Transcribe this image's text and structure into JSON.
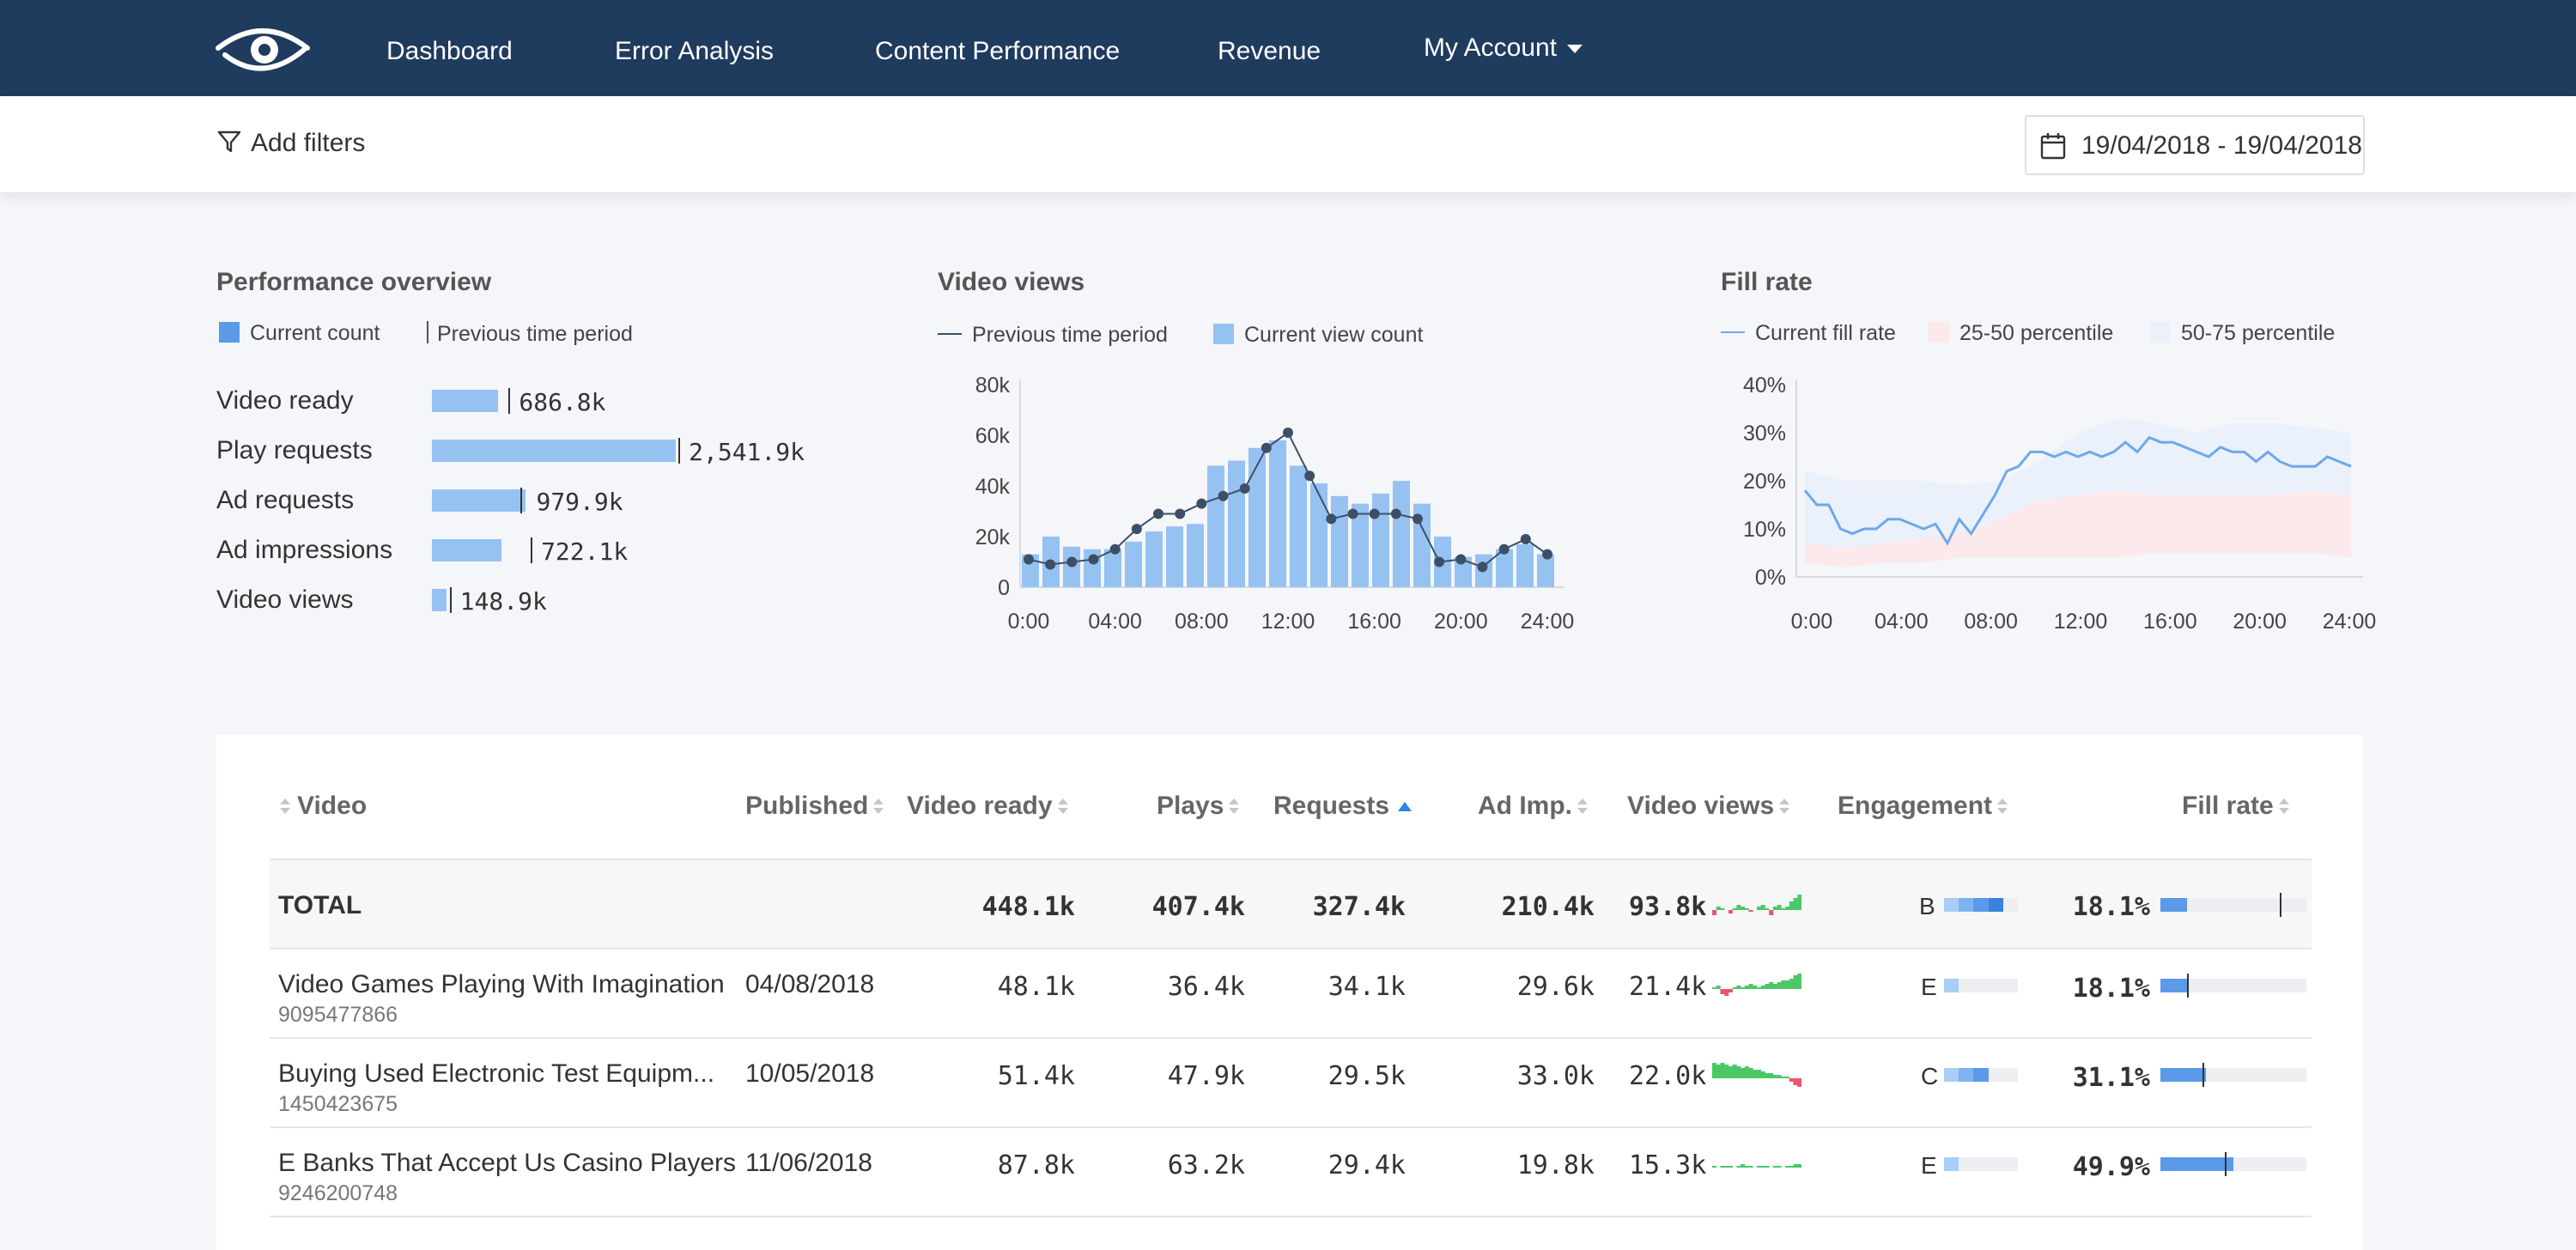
{
  "nav": {
    "items": [
      "Dashboard",
      "Error Analysis",
      "Content Performance",
      "Revenue"
    ],
    "account": "My Account"
  },
  "filters": {
    "add_label": "Add filters",
    "date_range": "19/04/2018 - 19/04/2018"
  },
  "performance": {
    "title": "Performance overview",
    "legend": [
      "Current count",
      "Previous time period"
    ],
    "rows": [
      {
        "label": "Video ready",
        "value": "686.8k",
        "current": 686.8,
        "previous": 800
      },
      {
        "label": "Play requests",
        "value": "2,541.9k",
        "current": 2541.9,
        "previous": 2570
      },
      {
        "label": "Ad requests",
        "value": "979.9k",
        "current": 979.9,
        "previous": 920
      },
      {
        "label": "Ad impressions",
        "value": "722.1k",
        "current": 722.1,
        "previous": 1030
      },
      {
        "label": "Video views",
        "value": "148.9k",
        "current": 148.9,
        "previous": 185
      }
    ]
  },
  "colors": {
    "nav_bg": "#1f3b5e",
    "bar": "#96c2f2",
    "line": "#3d4f66",
    "fill_line": "#6ea8ec",
    "band_low": "#fbe9ec",
    "band_high": "#eaf1fb",
    "positive": "#4cc766",
    "negative": "#e8566d",
    "accent": "#2e82ec"
  },
  "video_views": {
    "title": "Video views",
    "legend": [
      "Previous time period",
      "Current view count"
    ],
    "chart_data": {
      "type": "bar",
      "x_ticks": [
        "0:00",
        "04:00",
        "08:00",
        "12:00",
        "16:00",
        "20:00",
        "24:00"
      ],
      "y_ticks": [
        "80k",
        "60k",
        "40k",
        "20k",
        "0"
      ],
      "ylim": [
        0,
        80000
      ],
      "series": [
        {
          "name": "Current view count",
          "type": "bar",
          "values": [
            13000,
            20000,
            16000,
            15000,
            15000,
            18000,
            22000,
            24000,
            25000,
            48000,
            50000,
            55000,
            58000,
            48000,
            41000,
            36000,
            33000,
            37000,
            42000,
            33000,
            20000,
            12000,
            13000,
            15000,
            17000,
            13000
          ]
        },
        {
          "name": "Previous time period",
          "type": "line",
          "values": [
            11000,
            9000,
            10000,
            11000,
            15000,
            23000,
            29000,
            29000,
            33000,
            36000,
            39000,
            55000,
            61000,
            44000,
            27000,
            29000,
            29000,
            29000,
            27000,
            10000,
            11000,
            8000,
            15000,
            19000,
            13000
          ]
        }
      ]
    }
  },
  "fill_rate": {
    "title": "Fill rate",
    "legend": [
      "Current fill rate",
      "25-50 percentile",
      "50-75 percentile"
    ],
    "chart_data": {
      "type": "line",
      "x_ticks": [
        "0:00",
        "04:00",
        "08:00",
        "12:00",
        "16:00",
        "20:00",
        "24:00"
      ],
      "y_ticks": [
        "40%",
        "30%",
        "20%",
        "10%",
        "0%"
      ],
      "ylim": [
        0,
        40
      ],
      "current": [
        18,
        15,
        15,
        10,
        9,
        10,
        10,
        12,
        12,
        11,
        10,
        11,
        7,
        12,
        9,
        13,
        17,
        22,
        23,
        26,
        26,
        25,
        26,
        25,
        26,
        25,
        26,
        28,
        26,
        29,
        28,
        28,
        27,
        26,
        25,
        27,
        26,
        26,
        24,
        26,
        24,
        23,
        23,
        23,
        25,
        24,
        23
      ],
      "band_25_50": {
        "low": [
          3,
          2,
          3,
          3,
          4,
          4,
          4,
          4,
          4,
          5,
          5,
          5,
          5,
          5,
          4
        ],
        "high": [
          7,
          6,
          7,
          8,
          9,
          12,
          16,
          17,
          18,
          17,
          17,
          17,
          17,
          18,
          17
        ]
      },
      "band_50_75": {
        "low": [
          7,
          6,
          7,
          8,
          9,
          12,
          16,
          17,
          18,
          17,
          17,
          17,
          17,
          18,
          17
        ],
        "high": [
          22,
          20,
          20,
          20,
          19,
          20,
          24,
          30,
          33,
          32,
          30,
          32,
          32,
          31,
          30
        ]
      }
    }
  },
  "table": {
    "headers": {
      "video": "Video",
      "published": "Published",
      "video_ready": "Video ready",
      "plays": "Plays",
      "requests": "Requests",
      "ad_imp": "Ad Imp.",
      "video_views": "Video views",
      "engagement": "Engagement",
      "fill_rate": "Fill rate"
    },
    "total": {
      "label": "TOTAL",
      "video_ready": "448.1k",
      "plays": "407.4k",
      "requests": "327.4k",
      "ad_imp": "210.4k",
      "video_views": "93.8k",
      "engagement": "B",
      "fill_rate": "18.1%",
      "fill_value": 18.1,
      "fill_prev": 82,
      "spark": [
        -3,
        2,
        1,
        0,
        -2,
        1,
        3,
        2,
        1,
        -1,
        0,
        2,
        3,
        1,
        -3,
        2,
        3,
        1,
        2,
        5,
        7,
        9
      ]
    },
    "rows": [
      {
        "title": "Video Games Playing With Imagination",
        "id": "9095477866",
        "published": "04/08/2018",
        "video_ready": "48.1k",
        "plays": "36.4k",
        "requests": "34.1k",
        "ad_imp": "29.6k",
        "video_views": "21.4k",
        "engagement": "E",
        "fill_rate": "18.1%",
        "fill_value": 18.1,
        "fill_prev": 18,
        "spark": [
          1,
          2,
          -3,
          -4,
          -2,
          1,
          2,
          1,
          2,
          3,
          2,
          1,
          2,
          3,
          4,
          3,
          4,
          5,
          5,
          6,
          8,
          9
        ]
      },
      {
        "title": "Buying Used Electronic Test Equipm...",
        "id": "1450423675",
        "published": "10/05/2018",
        "video_ready": "51.4k",
        "plays": "47.9k",
        "requests": "29.5k",
        "ad_imp": "33.0k",
        "video_views": "22.0k",
        "engagement": "C",
        "fill_rate": "31.1%",
        "fill_value": 31.1,
        "fill_prev": 29,
        "spark": [
          9,
          8,
          9,
          8,
          7,
          8,
          7,
          6,
          7,
          6,
          5,
          5,
          4,
          3,
          3,
          2,
          2,
          1,
          1,
          -2,
          -4,
          -5
        ]
      },
      {
        "title": "E Banks That Accept Us Casino Players",
        "id": "9246200748",
        "published": "11/06/2018",
        "video_ready": "87.8k",
        "plays": "63.2k",
        "requests": "29.4k",
        "ad_imp": "19.8k",
        "video_views": "15.3k",
        "engagement": "E",
        "fill_rate": "49.9%",
        "fill_value": 49.9,
        "fill_prev": 44,
        "spark": [
          1,
          0,
          1,
          1,
          1,
          0,
          1,
          2,
          1,
          1,
          0,
          1,
          1,
          1,
          0,
          1,
          1,
          0,
          1,
          1,
          2,
          2
        ]
      }
    ]
  }
}
